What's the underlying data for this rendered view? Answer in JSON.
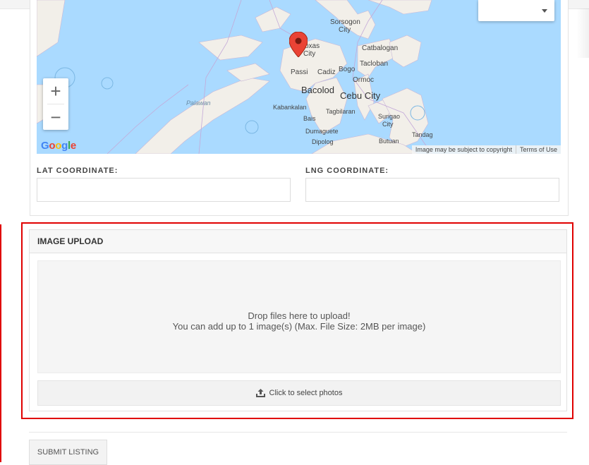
{
  "map": {
    "labels": {
      "sorsogon": "Sorsogon",
      "sorsogon2": "City",
      "roxas": "oxas",
      "roxas2": "City",
      "catbalogan": "Catbalogan",
      "tacloban": "Tacloban",
      "passi": "Passi",
      "cadiz": "Cadiz",
      "bogo": "Bogo",
      "ormoc": "Ormoc",
      "bacolod": "Bacolod",
      "cebu": "Cebu City",
      "kabankalan": "Kabankalan",
      "tagbilaran": "Tagbilaran",
      "bais": "Bais",
      "surigao": "Surigao",
      "surigao2": "City",
      "dumaguete": "Dumaguete",
      "tandag": "Tandag",
      "dipolog": "Dipolog",
      "butuan": "Butuan",
      "palawan": "Palawan"
    },
    "zoom_in": "+",
    "zoom_out": "−",
    "google_logo": {
      "letters": [
        "G",
        "o",
        "o",
        "g",
        "l",
        "e"
      ],
      "colors": [
        "#4285F4",
        "#EA4335",
        "#FBBC05",
        "#4285F4",
        "#34A853",
        "#EA4335"
      ]
    },
    "footer_copyright": "Image may be subject to copyright",
    "footer_terms": "Terms of Use",
    "pin_color": "#EA4335"
  },
  "coordinates": {
    "lat_label": "LAT COORDINATE:",
    "lng_label": "LNG COORDINATE:",
    "lat_value": "",
    "lng_value": ""
  },
  "upload": {
    "title": "IMAGE UPLOAD",
    "drop_line1": "Drop files here to upload!",
    "drop_line2": "You can add up to 1 image(s) (Max. File Size: 2MB per image)",
    "select_label": "Click to select photos",
    "highlight_color": "#e00000"
  },
  "submit_label": "SUBMIT LISTING"
}
